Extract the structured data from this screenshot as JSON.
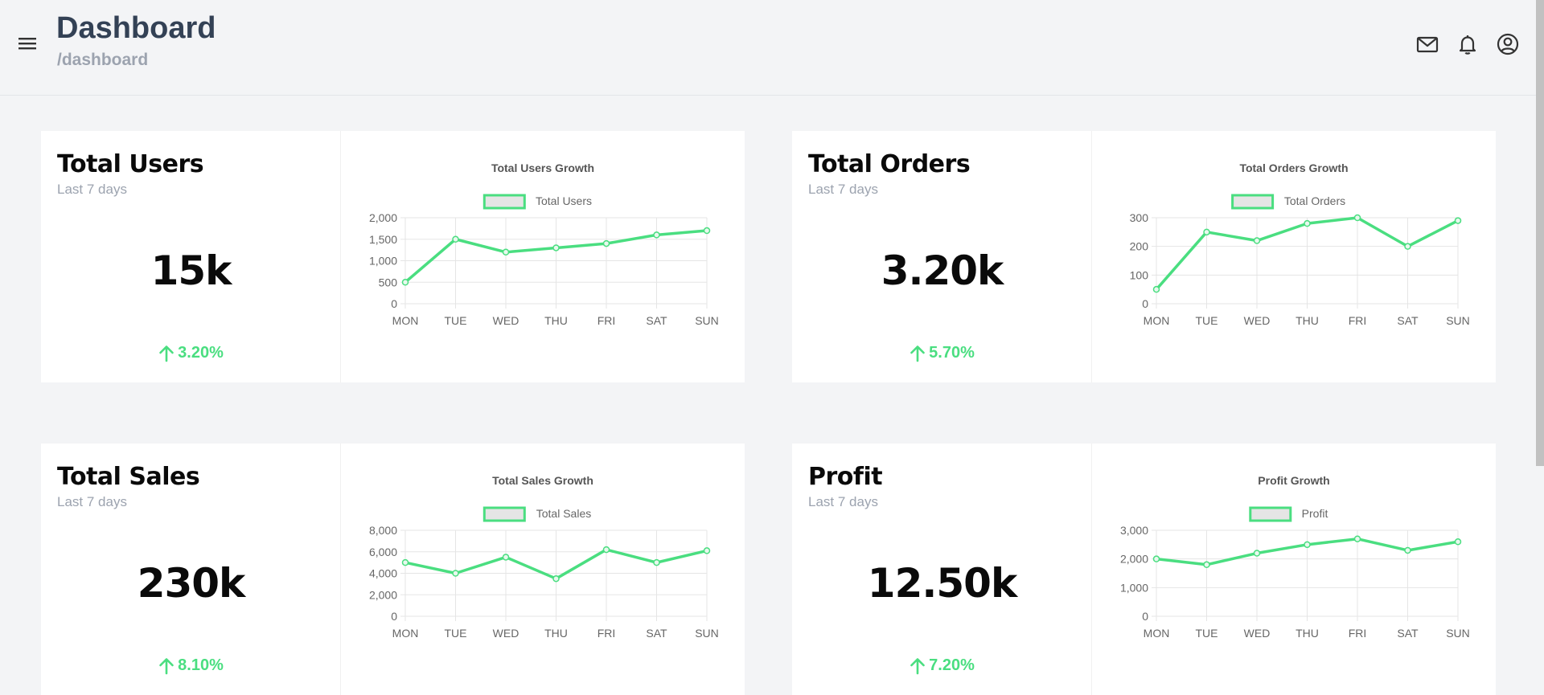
{
  "header": {
    "title": "Dashboard",
    "path": "/dashboard",
    "menu_icon": "hamburger-menu-icon",
    "icons": [
      "mail-icon",
      "bell-icon",
      "user-circle-icon"
    ]
  },
  "colors": {
    "accent": "#4ade80",
    "title": "#334155",
    "muted": "#9ca3af",
    "background": "#f3f4f6",
    "card": "#ffffff"
  },
  "cards": [
    {
      "title": "Total Users",
      "subtitle": "Last 7 days",
      "value": "15k",
      "change": "3.20%",
      "change_icon": "arrow-up-icon"
    },
    {
      "title": "Total Orders",
      "subtitle": "Last 7 days",
      "value": "3.20k",
      "change": "5.70%",
      "change_icon": "arrow-up-icon"
    },
    {
      "title": "Total Sales",
      "subtitle": "Last 7 days",
      "value": "230k",
      "change": "8.10%",
      "change_icon": "arrow-up-icon"
    },
    {
      "title": "Profit",
      "subtitle": "Last 7 days",
      "value": "12.50k",
      "change": "7.20%",
      "change_icon": "arrow-up-icon"
    }
  ],
  "chart_data": [
    {
      "type": "line",
      "title": "Total Users Growth",
      "categories": [
        "MON",
        "TUE",
        "WED",
        "THU",
        "FRI",
        "SAT",
        "SUN"
      ],
      "series": [
        {
          "name": "Total Users",
          "values": [
            500,
            1500,
            1200,
            1300,
            1400,
            1600,
            1700
          ]
        }
      ],
      "ylim": [
        0,
        2000
      ],
      "yticks": [
        0,
        500,
        1000,
        1500,
        2000
      ],
      "ytick_labels": [
        "0",
        "500",
        "1,000",
        "1,500",
        "2,000"
      ],
      "legend": "top",
      "grid": true
    },
    {
      "type": "line",
      "title": "Total Orders Growth",
      "categories": [
        "MON",
        "TUE",
        "WED",
        "THU",
        "FRI",
        "SAT",
        "SUN"
      ],
      "series": [
        {
          "name": "Total Orders",
          "values": [
            50,
            250,
            220,
            280,
            300,
            200,
            290
          ]
        }
      ],
      "ylim": [
        0,
        300
      ],
      "yticks": [
        0,
        100,
        200,
        300
      ],
      "ytick_labels": [
        "0",
        "100",
        "200",
        "300"
      ],
      "legend": "top",
      "grid": true
    },
    {
      "type": "line",
      "title": "Total Sales Growth",
      "categories": [
        "MON",
        "TUE",
        "WED",
        "THU",
        "FRI",
        "SAT",
        "SUN"
      ],
      "series": [
        {
          "name": "Total Sales",
          "values": [
            5000,
            4000,
            5500,
            3500,
            6200,
            5000,
            6100
          ]
        }
      ],
      "ylim": [
        0,
        8000
      ],
      "yticks": [
        0,
        2000,
        4000,
        6000,
        8000
      ],
      "ytick_labels": [
        "0",
        "2,000",
        "4,000",
        "6,000",
        "8,000"
      ],
      "legend": "top",
      "grid": true
    },
    {
      "type": "line",
      "title": "Profit Growth",
      "categories": [
        "MON",
        "TUE",
        "WED",
        "THU",
        "FRI",
        "SAT",
        "SUN"
      ],
      "series": [
        {
          "name": "Profit",
          "values": [
            2000,
            1800,
            2200,
            2500,
            2700,
            2300,
            2600
          ]
        }
      ],
      "ylim": [
        0,
        3000
      ],
      "yticks": [
        0,
        1000,
        2000,
        3000
      ],
      "ytick_labels": [
        "0",
        "1,000",
        "2,000",
        "3,000"
      ],
      "legend": "top",
      "grid": true
    }
  ]
}
